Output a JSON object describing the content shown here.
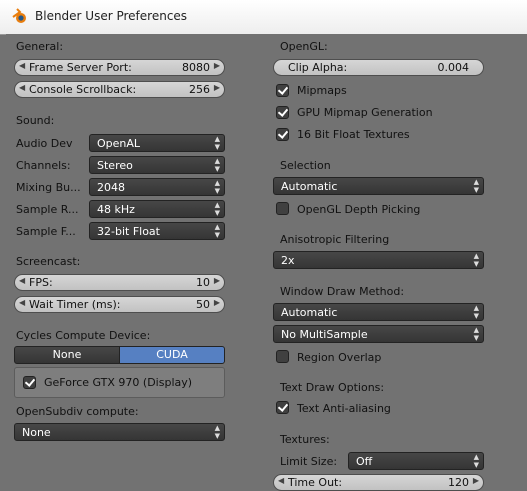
{
  "window": {
    "title": "Blender User Preferences"
  },
  "left": {
    "general": {
      "heading": "General:",
      "frame_server_port": {
        "label": "Frame Server Port:",
        "value": "8080"
      },
      "console_scrollback": {
        "label": "Console Scrollback:",
        "value": "256"
      }
    },
    "sound": {
      "heading": "Sound:",
      "audio_dev": {
        "label": "Audio Dev",
        "value": "OpenAL"
      },
      "channels": {
        "label": "Channels:",
        "value": "Stereo"
      },
      "mixing_buffer": {
        "label": "Mixing Bu...",
        "value": "2048"
      },
      "sample_rate": {
        "label": "Sample R...",
        "value": "48 kHz"
      },
      "sample_format": {
        "label": "Sample F...",
        "value": "32-bit Float"
      }
    },
    "screencast": {
      "heading": "Screencast:",
      "fps": {
        "label": "FPS:",
        "value": "10"
      },
      "wait_timer": {
        "label": "Wait Timer (ms):",
        "value": "50"
      }
    },
    "cycles": {
      "heading": "Cycles Compute Device:",
      "options": [
        "None",
        "CUDA"
      ],
      "selected": "CUDA",
      "device": {
        "label": "GeForce GTX 970 (Display)",
        "checked": true
      }
    },
    "opensubdiv": {
      "heading": "OpenSubdiv compute:",
      "value": "None"
    }
  },
  "right": {
    "opengl": {
      "heading": "OpenGL:",
      "clip_alpha": {
        "label": "Clip Alpha:",
        "value": "0.004"
      },
      "mipmaps": {
        "label": "Mipmaps",
        "checked": true
      },
      "gpu_mipmap": {
        "label": "GPU Mipmap Generation",
        "checked": true
      },
      "float_textures": {
        "label": "16 Bit Float Textures",
        "checked": true
      }
    },
    "selection": {
      "heading": "Selection",
      "value": "Automatic",
      "depth_picking": {
        "label": "OpenGL Depth Picking",
        "checked": false
      }
    },
    "anisotropic": {
      "heading": "Anisotropic Filtering",
      "value": "2x"
    },
    "window_draw": {
      "heading": "Window Draw Method:",
      "method": "Automatic",
      "multisample": "No MultiSample",
      "region_overlap": {
        "label": "Region Overlap",
        "checked": false
      }
    },
    "text_draw": {
      "heading": "Text Draw Options:",
      "antialiasing": {
        "label": "Text Anti-aliasing",
        "checked": true
      }
    },
    "textures": {
      "heading": "Textures:",
      "limit_size": {
        "label": "Limit Size:",
        "value": "Off"
      },
      "time_out": {
        "label": "Time Out:",
        "value": "120"
      }
    }
  },
  "colors": {
    "cuda_selected": "#5680c2",
    "panel_bg": "#727272",
    "dropdown_bg": "#3a3a3a"
  }
}
